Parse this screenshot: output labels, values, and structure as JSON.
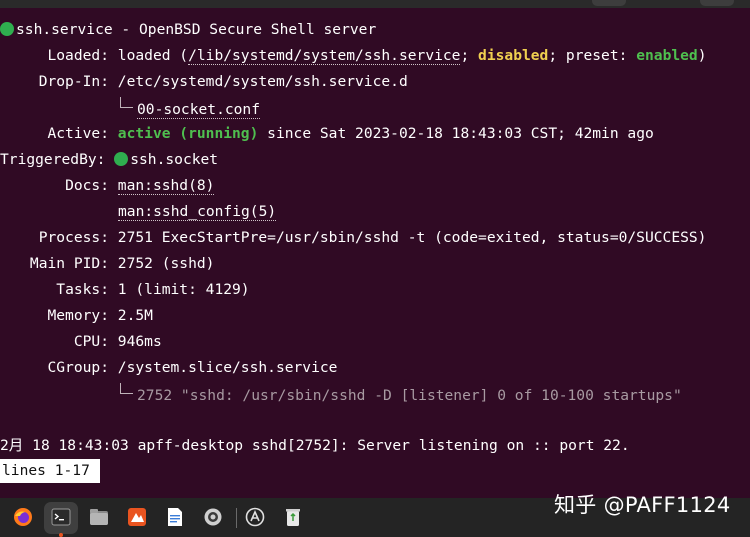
{
  "status": {
    "title_line": "ssh.service - OpenBSD Secure Shell server",
    "loaded_key": "Loaded:",
    "loaded_pre": "loaded (",
    "loaded_path": "/lib/systemd/system/ssh.service",
    "loaded_sep": "; ",
    "loaded_disabled": "disabled",
    "loaded_mid": "; preset: ",
    "loaded_enabled": "enabled",
    "loaded_post": ")",
    "dropin_key": "Drop-In:",
    "dropin_path": "/etc/systemd/system/ssh.service.d",
    "dropin_file": "00-socket.conf",
    "active_key": "Active:",
    "active_state": "active (running)",
    "active_rest": " since Sat 2023-02-18 18:43:03 CST; 42min ago",
    "triggered_key": "TriggeredBy:",
    "triggered_val": "ssh.socket",
    "docs_key": "Docs:",
    "docs_1": "man:sshd(8)",
    "docs_2": "man:sshd_config(5)",
    "process_key": "Process:",
    "process_val": "2751 ExecStartPre=/usr/sbin/sshd -t (code=exited, status=0/SUCCESS)",
    "mainpid_key": "Main PID:",
    "mainpid_val": "2752 (sshd)",
    "tasks_key": "Tasks:",
    "tasks_val": "1 (limit: 4129)",
    "memory_key": "Memory:",
    "memory_val": "2.5M",
    "cpu_key": "CPU:",
    "cpu_val": "946ms",
    "cgroup_key": "CGroup:",
    "cgroup_val": "/system.slice/ssh.service",
    "cgroup_proc": "2752 \"sshd: /usr/sbin/sshd -D [listener] 0 of 10-100 startups\"",
    "log_line": "2月 18 18:43:03 apff-desktop sshd[2752]: Server listening on :: port 22."
  },
  "pager": {
    "text": "lines 1-17"
  },
  "taskbar": {
    "icons": [
      "firefox-icon",
      "terminal-icon",
      "files-icon",
      "software-icon",
      "text-editor-icon",
      "settings-icon",
      "app-store-icon",
      "trash-icon"
    ]
  },
  "watermark": {
    "text": "知乎 @PAFF1124"
  },
  "colors": {
    "terminal_bg": "#300a24",
    "green": "#4fbf4f",
    "yellow": "#f0d050",
    "taskbar": "#242424"
  }
}
